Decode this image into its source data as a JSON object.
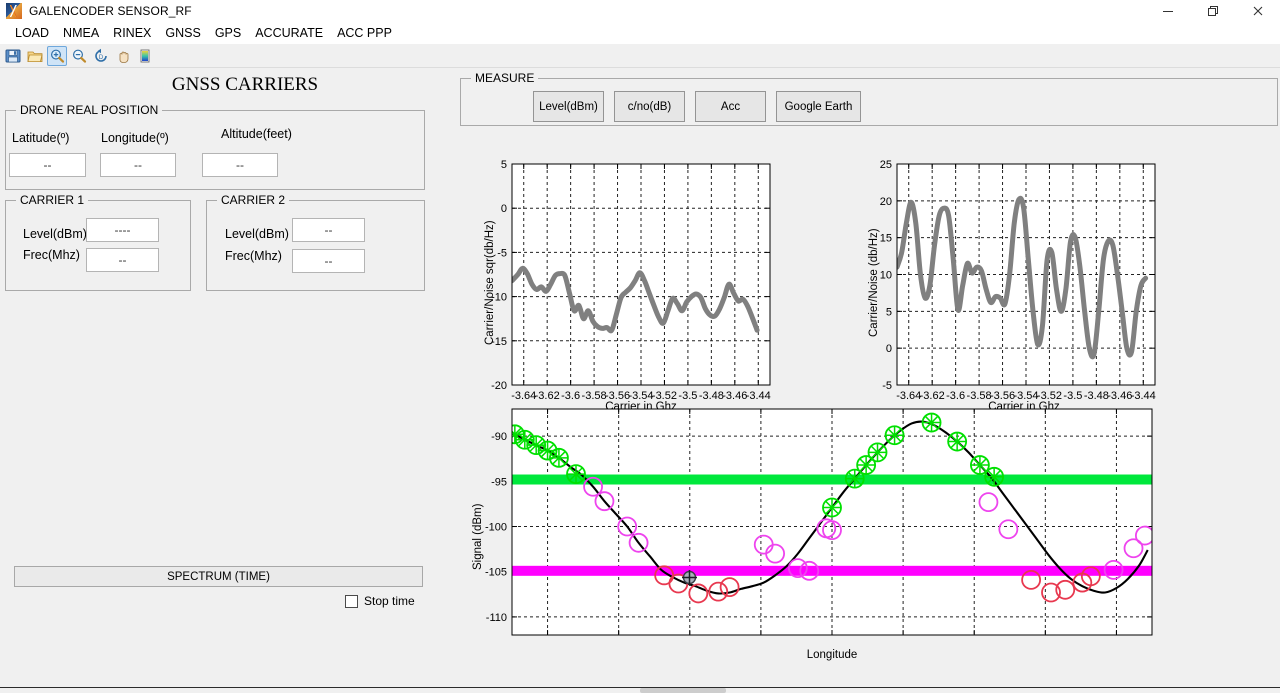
{
  "window": {
    "title": "GALENCODER SENSOR_RF",
    "icon": "matlab-app-icon",
    "controls": {
      "minimize": "minimize-icon",
      "maximize": "maximize-icon",
      "close": "close-icon"
    }
  },
  "menubar": {
    "items": [
      "LOAD",
      "NMEA",
      "RINEX",
      "GNSS",
      "GPS",
      "ACCURATE",
      "ACC PPP"
    ]
  },
  "toolbar": {
    "items": [
      {
        "name": "save-icon",
        "active": false
      },
      {
        "name": "open-folder-icon",
        "active": false
      },
      {
        "name": "zoom-in-icon",
        "active": true
      },
      {
        "name": "zoom-out-icon",
        "active": false
      },
      {
        "name": "restore-view-icon",
        "active": false
      },
      {
        "name": "pan-hand-icon",
        "active": false
      },
      {
        "name": "colorbar-icon",
        "active": false
      }
    ]
  },
  "left_panel": {
    "page_title": "GNSS CARRIERS",
    "drone_position": {
      "legend": "DRONE REAL POSITION",
      "fields": [
        {
          "label": "Latitude(º)",
          "value": "--"
        },
        {
          "label": "Longitude(º)",
          "value": "--"
        },
        {
          "label": "Altitude(feet)",
          "value": "--"
        }
      ]
    },
    "carrier1": {
      "legend": "CARRIER 1",
      "fields": [
        {
          "label": "Level(dBm)",
          "value": "----"
        },
        {
          "label": "Frec(Mhz)",
          "value": "--"
        }
      ]
    },
    "carrier2": {
      "legend": "CARRIER 2",
      "fields": [
        {
          "label": "Level(dBm)",
          "value": "--"
        },
        {
          "label": "Frec(Mhz)",
          "value": "--"
        }
      ]
    },
    "spectrum_button": "SPECTRUM (TIME)",
    "stop_time_label": "Stop time",
    "stop_time_checked": false
  },
  "measure_panel": {
    "legend": "MEASURE",
    "buttons": [
      "Level(dBm)",
      "c/no(dB)",
      "Acc",
      "Google Earth"
    ]
  },
  "colors": {
    "trace_gray": "#808080",
    "upper_limit_green": "#00E83C",
    "lower_limit_magenta": "#FF00FF",
    "marker_green": "#00E000",
    "marker_magenta": "#EE44EE",
    "marker_red": "#E8384F",
    "signal_line": "#000000",
    "panel_bg": "#F0F0F0",
    "plot_bg": "#FFFFFF"
  },
  "chart_data": [
    {
      "id": "carrier-noise-sqrt-plot",
      "type": "line",
      "title": "",
      "xlabel": "Carrier in Ghz",
      "ylabel": "Carrier/Noise sqr(db/Hz)",
      "xlim": [
        -3.65,
        -3.43
      ],
      "ylim": [
        -20,
        5
      ],
      "xticks": [
        "-3.64",
        "-3.62",
        "-3.6",
        "-3.58",
        "-3.56",
        "-3.54",
        "-3.52",
        "-3.5",
        "-3.48",
        "-3.46",
        "-3.44"
      ],
      "yticks": [
        "5",
        "0",
        "-5",
        "-10",
        "-15",
        "-20"
      ],
      "grid": true,
      "line_color": "#808080",
      "line_width": 5,
      "x": [
        -3.65,
        -3.645,
        -3.641,
        -3.637,
        -3.633,
        -3.629,
        -3.625,
        -3.621,
        -3.617,
        -3.613,
        -3.609,
        -3.605,
        -3.601,
        -3.597,
        -3.593,
        -3.589,
        -3.585,
        -3.581,
        -3.577,
        -3.573,
        -3.569,
        -3.565,
        -3.561,
        -3.557,
        -3.553,
        -3.549,
        -3.545,
        -3.541,
        -3.537,
        -3.533,
        -3.529,
        -3.525,
        -3.521,
        -3.517,
        -3.513,
        -3.509,
        -3.505,
        -3.501,
        -3.497,
        -3.493,
        -3.489,
        -3.485,
        -3.481,
        -3.477,
        -3.473,
        -3.469,
        -3.465,
        -3.461,
        -3.457,
        -3.453,
        -3.449,
        -3.445,
        -3.441
      ],
      "y": [
        -8.2,
        -7.5,
        -6.8,
        -7.4,
        -8.6,
        -9.2,
        -8.9,
        -9.4,
        -8.6,
        -7.6,
        -7.4,
        -7.6,
        -9.6,
        -11.6,
        -11.0,
        -12.5,
        -11.6,
        -12.8,
        -13.4,
        -13.6,
        -13.5,
        -13.8,
        -12.0,
        -10.1,
        -9.5,
        -9.0,
        -8.2,
        -7.3,
        -8.2,
        -9.6,
        -11.0,
        -12.3,
        -13.0,
        -11.6,
        -10.2,
        -10.8,
        -11.6,
        -10.6,
        -10.0,
        -9.7,
        -10.1,
        -11.4,
        -12.1,
        -12.2,
        -11.4,
        -10.1,
        -8.6,
        -9.6,
        -10.5,
        -10.3,
        -11.1,
        -12.4,
        -13.8
      ]
    },
    {
      "id": "carrier-noise-plot",
      "type": "line",
      "title": "",
      "xlabel": "Carrier in Ghz",
      "ylabel": "Carrier/Noise (db/Hz)",
      "xlim": [
        -3.65,
        -3.43
      ],
      "ylim": [
        -5,
        25
      ],
      "xticks": [
        "-3.64",
        "-3.62",
        "-3.6",
        "-3.58",
        "-3.56",
        "-3.54",
        "-3.52",
        "-3.5",
        "-3.48",
        "-3.46",
        "-3.44"
      ],
      "yticks": [
        "25",
        "20",
        "15",
        "10",
        "5",
        "0",
        "-5"
      ],
      "grid": true,
      "line_color": "#808080",
      "line_width": 5,
      "x": [
        -3.65,
        -3.646,
        -3.642,
        -3.638,
        -3.634,
        -3.63,
        -3.626,
        -3.622,
        -3.618,
        -3.614,
        -3.61,
        -3.606,
        -3.602,
        -3.598,
        -3.594,
        -3.59,
        -3.586,
        -3.582,
        -3.578,
        -3.574,
        -3.57,
        -3.566,
        -3.562,
        -3.558,
        -3.554,
        -3.55,
        -3.546,
        -3.542,
        -3.538,
        -3.534,
        -3.53,
        -3.526,
        -3.522,
        -3.518,
        -3.514,
        -3.51,
        -3.506,
        -3.502,
        -3.498,
        -3.494,
        -3.49,
        -3.486,
        -3.482,
        -3.478,
        -3.474,
        -3.47,
        -3.466,
        -3.462,
        -3.458,
        -3.454,
        -3.45,
        -3.446,
        -3.442,
        -3.438
      ],
      "y": [
        11.0,
        13.0,
        17.0,
        19.8,
        17.0,
        10.0,
        6.8,
        8.5,
        14.0,
        18.0,
        19.0,
        18.0,
        12.0,
        5.2,
        8.5,
        11.5,
        10.2,
        11.0,
        10.5,
        8.0,
        6.2,
        7.0,
        6.8,
        6.0,
        10.0,
        17.0,
        20.2,
        19.0,
        12.0,
        5.0,
        0.5,
        3.0,
        12.0,
        13.0,
        8.0,
        5.0,
        8.0,
        14.5,
        15.0,
        11.0,
        5.0,
        0.0,
        -0.8,
        5.0,
        12.0,
        14.5,
        14.0,
        10.0,
        5.0,
        0.0,
        -0.5,
        5.0,
        8.5,
        9.5
      ]
    },
    {
      "id": "signal-longitude-plot",
      "type": "line",
      "title": "",
      "xlabel": "Longitude",
      "ylabel": "Signal (dBm)",
      "xlim": [
        -3.6375,
        -3.5925
      ],
      "ylim": [
        -112,
        -87
      ],
      "xticks": [
        "-3.635",
        "-3.63",
        "-3.625",
        "-3.62",
        "-3.615",
        "-3.61",
        "-3.605",
        "-3.6",
        "-3.595"
      ],
      "yticks": [
        "-90",
        "-95",
        "-100",
        "-105",
        "-110"
      ],
      "grid": true,
      "upper_threshold": -94.8,
      "lower_threshold": -104.9,
      "upper_threshold_color": "#00E83C",
      "lower_threshold_color": "#FF00FF",
      "line_color": "#000000",
      "x": [
        -3.6373,
        -3.6366,
        -3.6358,
        -3.635,
        -3.6342,
        -3.6334,
        -3.6326,
        -3.6318,
        -3.631,
        -3.6302,
        -3.6294,
        -3.6286,
        -3.6278,
        -3.627,
        -3.6262,
        -3.6254,
        -3.6246,
        -3.6238,
        -3.623,
        -3.6222,
        -3.6214,
        -3.6206,
        -3.6198,
        -3.619,
        -3.6182,
        -3.6174,
        -3.6166,
        -3.6158,
        -3.615,
        -3.6142,
        -3.6134,
        -3.6126,
        -3.6118,
        -3.611,
        -3.6102,
        -3.6094,
        -3.6086,
        -3.6078,
        -3.607,
        -3.6062,
        -3.6054,
        -3.6046,
        -3.6038,
        -3.603,
        -3.6022,
        -3.6014,
        -3.6006,
        -3.5998,
        -3.599,
        -3.5982,
        -3.5974,
        -3.5966,
        -3.5958,
        -3.595,
        -3.5942,
        -3.5934,
        -3.5928
      ],
      "y": [
        -89.8,
        -90.4,
        -91.0,
        -91.6,
        -92.4,
        -93.4,
        -94.3,
        -95.6,
        -97.2,
        -98.6,
        -100.0,
        -101.8,
        -103.3,
        -104.8,
        -105.6,
        -106.2,
        -106.6,
        -107.1,
        -107.4,
        -107.3,
        -106.9,
        -106.6,
        -106.2,
        -105.4,
        -104.4,
        -103.0,
        -101.3,
        -99.6,
        -97.9,
        -96.2,
        -94.7,
        -93.2,
        -91.8,
        -90.5,
        -89.4,
        -88.6,
        -88.4,
        -88.8,
        -89.6,
        -90.6,
        -91.8,
        -93.2,
        -94.6,
        -96.3,
        -98.0,
        -99.7,
        -101.4,
        -103.1,
        -104.6,
        -105.8,
        -106.6,
        -107.1,
        -107.3,
        -106.8,
        -105.8,
        -104.3,
        -102.6
      ],
      "markers_green": [
        [
          -3.6373,
          -89.8
        ],
        [
          -3.6366,
          -90.4
        ],
        [
          -3.6358,
          -91.0
        ],
        [
          -3.635,
          -91.6
        ],
        [
          -3.6342,
          -92.4
        ],
        [
          -3.633,
          -94.2
        ],
        [
          -3.615,
          -97.9
        ],
        [
          -3.6134,
          -94.7
        ],
        [
          -3.6126,
          -93.2
        ],
        [
          -3.6118,
          -91.8
        ],
        [
          -3.6106,
          -89.9
        ],
        [
          -3.608,
          -88.5
        ],
        [
          -3.6062,
          -90.6
        ],
        [
          -3.6046,
          -93.2
        ],
        [
          -3.6036,
          -94.5
        ]
      ],
      "markers_magenta": [
        [
          -3.6318,
          -95.6
        ],
        [
          -3.631,
          -97.2
        ],
        [
          -3.6294,
          -100.0
        ],
        [
          -3.6286,
          -101.8
        ],
        [
          -3.6198,
          -102.0
        ],
        [
          -3.619,
          -103.0
        ],
        [
          -3.6174,
          -104.6
        ],
        [
          -3.6166,
          -104.9
        ],
        [
          -3.6154,
          -100.2
        ],
        [
          -3.615,
          -100.4
        ],
        [
          -3.604,
          -97.3
        ],
        [
          -3.6026,
          -100.3
        ],
        [
          -3.5952,
          -104.8
        ],
        [
          -3.5938,
          -102.4
        ],
        [
          -3.593,
          -101.0
        ]
      ],
      "markers_red": [
        [
          -3.6268,
          -105.4
        ],
        [
          -3.6258,
          -106.3
        ],
        [
          -3.6244,
          -107.4
        ],
        [
          -3.623,
          -107.2
        ],
        [
          -3.6222,
          -106.7
        ],
        [
          -3.601,
          -105.9
        ],
        [
          -3.5996,
          -107.3
        ],
        [
          -3.5986,
          -107.0
        ],
        [
          -3.5974,
          -106.2
        ],
        [
          -3.5968,
          -105.5
        ]
      ],
      "cursor": {
        "x": -3.6222,
        "y": -105.0,
        "icon": "crosshair-cursor"
      }
    }
  ]
}
